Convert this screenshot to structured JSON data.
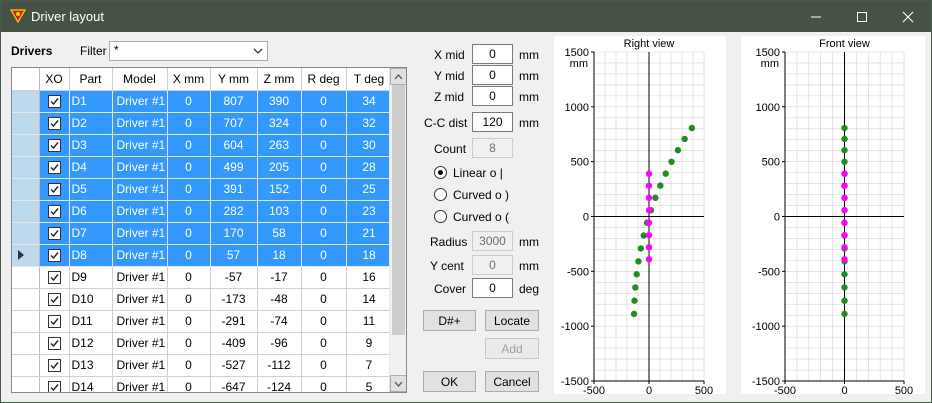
{
  "window": {
    "title": "Driver layout"
  },
  "panel": {
    "drivers_label": "Drivers",
    "filter_label": "Filter",
    "filter_value": "*"
  },
  "grid": {
    "columns": [
      "XO",
      "Part",
      "Model",
      "X mm",
      "Y mm",
      "Z mm",
      "R deg",
      "T deg"
    ],
    "rows": [
      {
        "checked": true,
        "part": "D1",
        "model": "Driver #1",
        "x": "0",
        "y": "807",
        "z": "390",
        "r": "0",
        "t": "34",
        "selected": true
      },
      {
        "checked": true,
        "part": "D2",
        "model": "Driver #1",
        "x": "0",
        "y": "707",
        "z": "324",
        "r": "0",
        "t": "32",
        "selected": true
      },
      {
        "checked": true,
        "part": "D3",
        "model": "Driver #1",
        "x": "0",
        "y": "604",
        "z": "263",
        "r": "0",
        "t": "30",
        "selected": true
      },
      {
        "checked": true,
        "part": "D4",
        "model": "Driver #1",
        "x": "0",
        "y": "499",
        "z": "205",
        "r": "0",
        "t": "28",
        "selected": true
      },
      {
        "checked": true,
        "part": "D5",
        "model": "Driver #1",
        "x": "0",
        "y": "391",
        "z": "152",
        "r": "0",
        "t": "25",
        "selected": true
      },
      {
        "checked": true,
        "part": "D6",
        "model": "Driver #1",
        "x": "0",
        "y": "282",
        "z": "103",
        "r": "0",
        "t": "23",
        "selected": true
      },
      {
        "checked": true,
        "part": "D7",
        "model": "Driver #1",
        "x": "0",
        "y": "170",
        "z": "58",
        "r": "0",
        "t": "21",
        "selected": true
      },
      {
        "checked": true,
        "part": "D8",
        "model": "Driver #1",
        "x": "0",
        "y": "57",
        "z": "18",
        "r": "0",
        "t": "18",
        "selected": true,
        "current": true
      },
      {
        "checked": true,
        "part": "D9",
        "model": "Driver #1",
        "x": "0",
        "y": "-57",
        "z": "-17",
        "r": "0",
        "t": "16",
        "selected": false
      },
      {
        "checked": true,
        "part": "D10",
        "model": "Driver #1",
        "x": "0",
        "y": "-173",
        "z": "-48",
        "r": "0",
        "t": "14",
        "selected": false
      },
      {
        "checked": true,
        "part": "D11",
        "model": "Driver #1",
        "x": "0",
        "y": "-291",
        "z": "-74",
        "r": "0",
        "t": "11",
        "selected": false
      },
      {
        "checked": true,
        "part": "D12",
        "model": "Driver #1",
        "x": "0",
        "y": "-409",
        "z": "-96",
        "r": "0",
        "t": "9",
        "selected": false
      },
      {
        "checked": true,
        "part": "D13",
        "model": "Driver #1",
        "x": "0",
        "y": "-527",
        "z": "-112",
        "r": "0",
        "t": "7",
        "selected": false
      },
      {
        "checked": true,
        "part": "D14",
        "model": "Driver #1",
        "x": "0",
        "y": "-647",
        "z": "-124",
        "r": "0",
        "t": "5",
        "selected": false
      }
    ]
  },
  "params": {
    "x_mid_label": "X mid",
    "x_mid": "0",
    "x_mid_unit": "mm",
    "y_mid_label": "Y mid",
    "y_mid": "0",
    "y_mid_unit": "mm",
    "z_mid_label": "Z mid",
    "z_mid": "0",
    "z_mid_unit": "mm",
    "cc_dist_label": "C-C dist",
    "cc_dist": "120",
    "cc_dist_unit": "mm",
    "count_label": "Count",
    "count": "8",
    "mode_linear": "Linear  o  |",
    "mode_curved_right": "Curved  o  )",
    "mode_curved_left": "Curved  o  (",
    "radius_label": "Radius",
    "radius": "3000",
    "radius_unit": "mm",
    "ycent_label": "Y cent",
    "ycent": "0",
    "ycent_unit": "mm",
    "cover_label": "Cover",
    "cover": "0",
    "cover_unit": "deg"
  },
  "buttons": {
    "dsharp": "D#+",
    "locate": "Locate",
    "add": "Add",
    "ok": "OK",
    "cancel": "Cancel"
  },
  "colors": {
    "titlebar": "#475246",
    "selection": "#3399ff",
    "point_green": "#228b22",
    "point_magenta": "#ff00ff"
  },
  "chart_data": [
    {
      "type": "scatter",
      "title": "Right view",
      "unit_label": "mm",
      "xlim": [
        -500,
        500
      ],
      "ylim": [
        -1500,
        1500
      ],
      "xticks": [
        "-500",
        "0",
        "500"
      ],
      "yticks": [
        "1500",
        "1000",
        "500",
        "0",
        "-500",
        "-1000",
        "-1500"
      ],
      "grid": true,
      "series": [
        {
          "color": "#228b22",
          "points": [
            [
              390,
              807
            ],
            [
              324,
              707
            ],
            [
              263,
              604
            ],
            [
              205,
              499
            ],
            [
              152,
              391
            ],
            [
              103,
              282
            ],
            [
              58,
              170
            ],
            [
              18,
              57
            ],
            [
              -17,
              -57
            ],
            [
              -48,
              -173
            ],
            [
              -74,
              -291
            ],
            [
              -96,
              -409
            ],
            [
              -112,
              -527
            ],
            [
              -124,
              -647
            ],
            [
              -132,
              -768
            ],
            [
              -136,
              -888
            ]
          ]
        },
        {
          "color": "#ff00ff",
          "points": [
            [
              0,
              390
            ],
            [
              0,
              280
            ],
            [
              0,
              170
            ],
            [
              0,
              57
            ],
            [
              0,
              -57
            ],
            [
              0,
              -170
            ],
            [
              0,
              -280
            ],
            [
              0,
              -390
            ]
          ]
        }
      ]
    },
    {
      "type": "scatter",
      "title": "Front view",
      "unit_label": "mm",
      "xlim": [
        -500,
        500
      ],
      "ylim": [
        -1500,
        1500
      ],
      "xticks": [
        "-500",
        "0",
        "500"
      ],
      "yticks": [
        "1500",
        "1000",
        "500",
        "0",
        "-500",
        "-1000",
        "-1500"
      ],
      "grid": true,
      "series": [
        {
          "color": "#228b22",
          "points": [
            [
              0,
              807
            ],
            [
              0,
              707
            ],
            [
              0,
              604
            ],
            [
              0,
              499
            ],
            [
              0,
              391
            ],
            [
              0,
              282
            ],
            [
              0,
              170
            ],
            [
              0,
              57
            ],
            [
              0,
              -57
            ],
            [
              0,
              -173
            ],
            [
              0,
              -291
            ],
            [
              0,
              -409
            ],
            [
              0,
              -527
            ],
            [
              0,
              -647
            ],
            [
              0,
              -768
            ],
            [
              0,
              -888
            ]
          ]
        },
        {
          "color": "#ff00ff",
          "points": [
            [
              0,
              390
            ],
            [
              0,
              280
            ],
            [
              0,
              170
            ],
            [
              0,
              57
            ],
            [
              0,
              -57
            ],
            [
              0,
              -170
            ],
            [
              0,
              -280
            ],
            [
              0,
              -390
            ]
          ]
        }
      ]
    }
  ]
}
